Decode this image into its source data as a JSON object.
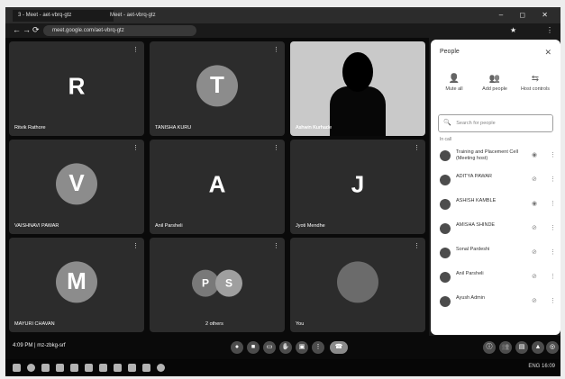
{
  "browser": {
    "tabs": [
      "3 - Meet - aet-vbrq-gtz",
      "Meet - aet-vbrq-gtz"
    ],
    "url": "meet.google.com/aet-vbrq-gtz",
    "window_controls": "– ◻ ✕",
    "nav": {
      "back": "←",
      "forward": "→",
      "reload": "⟳"
    },
    "ext_icons": [
      "★",
      "⋮"
    ]
  },
  "tiles": [
    {
      "letter": "R",
      "name": "Ritvik Rathore",
      "avatar": "letter"
    },
    {
      "letter": "T",
      "name": "TANISHA KURU",
      "avatar": "circle"
    },
    {
      "letter": "",
      "name": "Ashwin Kurhade",
      "avatar": "video"
    },
    {
      "letter": "V",
      "name": "VAISHNAVI PAWAR",
      "avatar": "circle"
    },
    {
      "letter": "A",
      "name": "Anil Parsheli",
      "avatar": "letter"
    },
    {
      "letter": "J",
      "name": "Jyoti Mendhe",
      "avatar": "letter"
    },
    {
      "letter": "M",
      "name": "MAYURI CHAVAN",
      "avatar": "circle"
    },
    {
      "letter": "PS",
      "name": "2 others",
      "avatar": "pair"
    },
    {
      "letter": "",
      "name": "You",
      "avatar": "emblem"
    }
  ],
  "bottom": {
    "time_meeting": "4:09 PM | mz-zbkg-srf"
  },
  "panel": {
    "title": "People",
    "actions": [
      {
        "icon": "👤",
        "label": "Mute all"
      },
      {
        "icon": "👥",
        "label": "Add people"
      },
      {
        "icon": "⇆",
        "label": "Host controls"
      }
    ],
    "search_placeholder": "Search for people",
    "section": "In call",
    "participants": [
      {
        "name": "Training and Placement Cell (Meeting host)"
      },
      {
        "name": "ADITYA PAWAR"
      },
      {
        "name": "ASHISH KAMBLE"
      },
      {
        "name": "AMISHA SHINDE"
      },
      {
        "name": "Sonal Pardeshi"
      },
      {
        "name": "Anil Parsheli"
      },
      {
        "name": "Ayush Admin"
      }
    ]
  },
  "taskbar": {
    "tray_text": "ENG 16:09"
  }
}
